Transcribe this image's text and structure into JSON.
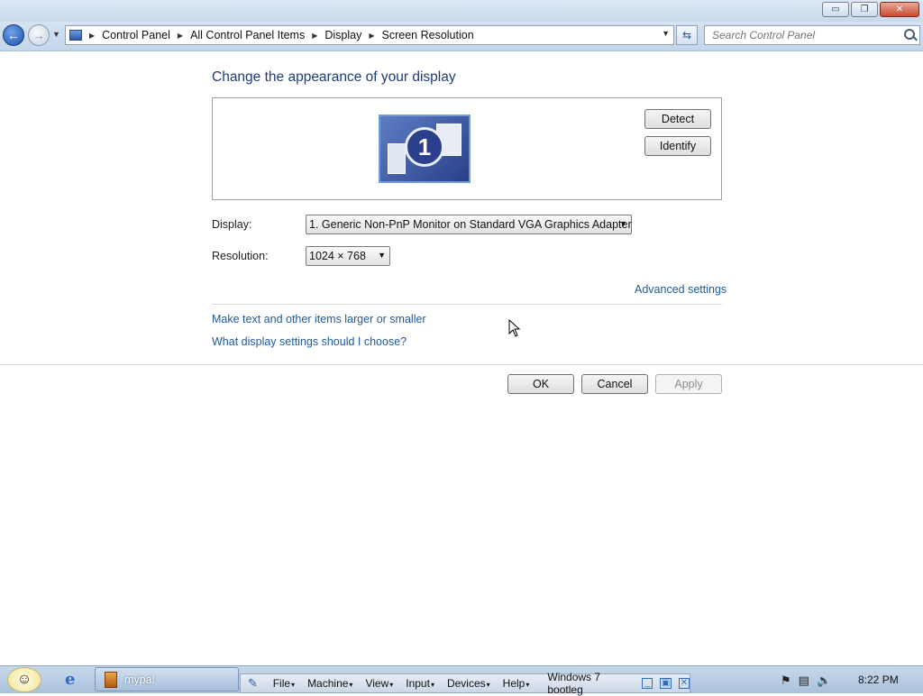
{
  "window": {
    "min_glyph": "▭",
    "max_glyph": "❐",
    "close_glyph": "✕"
  },
  "addressbar": {
    "breadcrumbs": [
      "Control Panel",
      "All Control Panel Items",
      "Display",
      "Screen Resolution"
    ],
    "search_placeholder": "Search Control Panel"
  },
  "page": {
    "heading": "Change the appearance of your display",
    "monitor_number": "1",
    "detect_label": "Detect",
    "identify_label": "Identify",
    "display_label": "Display:",
    "display_value": "1. Generic Non-PnP Monitor on Standard VGA Graphics Adapter",
    "resolution_label": "Resolution:",
    "resolution_value": "1024 × 768",
    "advanced_link": "Advanced settings",
    "link_larger_text": "Make text and other items larger or smaller",
    "link_which_settings": "What display settings should I choose?",
    "ok_label": "OK",
    "cancel_label": "Cancel",
    "apply_label": "Apply"
  },
  "taskbar": {
    "task_label": "mypal",
    "vbox_menus": [
      "File",
      "Machine",
      "View",
      "Input",
      "Devices",
      "Help"
    ],
    "vbox_title": "Windows 7 bootleg",
    "clock": "8:22 PM"
  },
  "colors": {
    "heading": "#1e3c7a",
    "link": "#1e5a9c",
    "titlebar": "#c9d9ec"
  }
}
